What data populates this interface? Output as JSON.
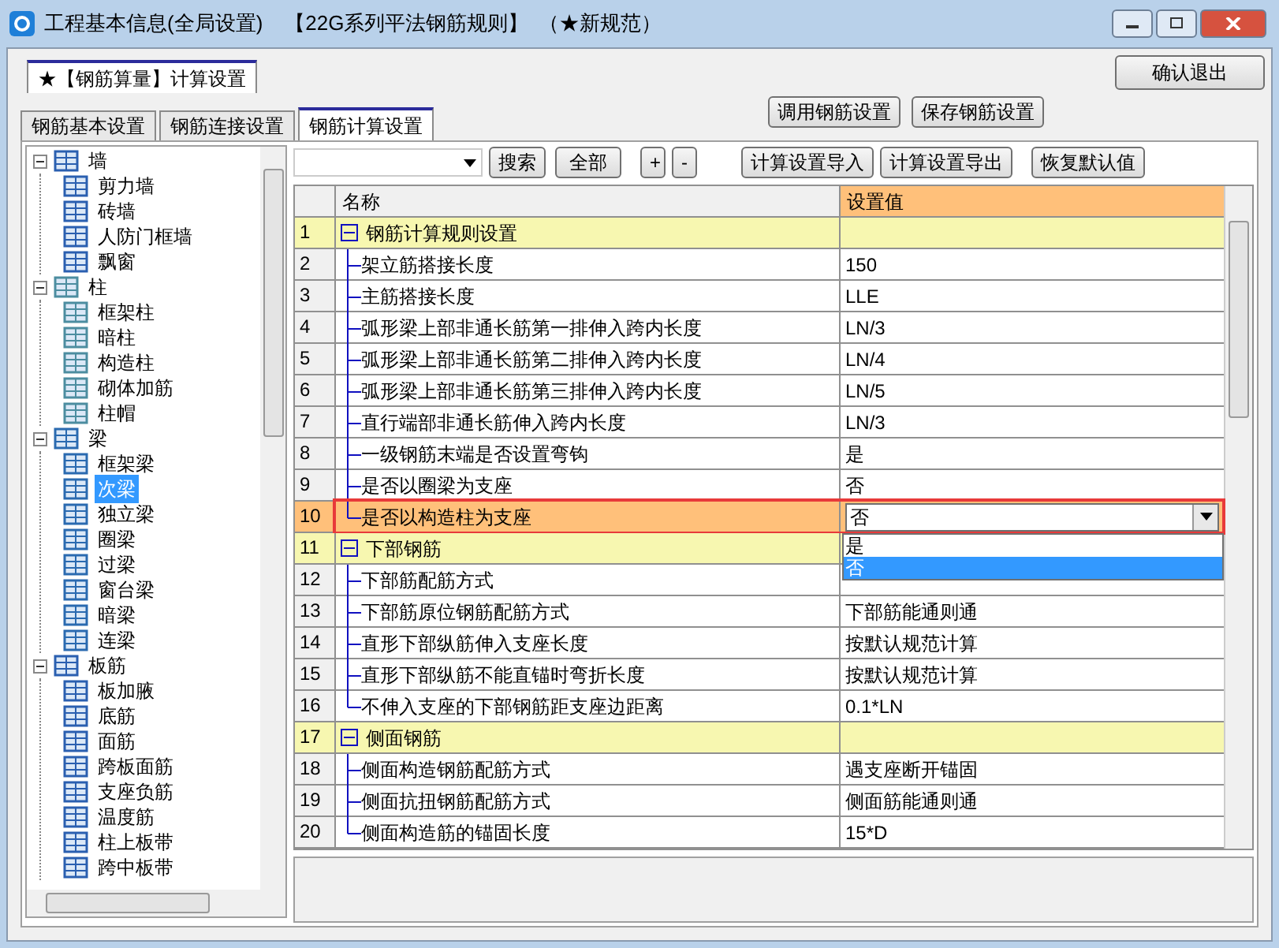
{
  "window": {
    "title": "工程基本信息(全局设置)",
    "rule_set": "【22G系列平法钢筋规则】",
    "note": "（★新规范）"
  },
  "outer_tabs": [
    {
      "label": "★【钢筋算量】计算设置",
      "selected": true
    }
  ],
  "confirm_button": "确认退出",
  "tabs": [
    {
      "label": "钢筋基本设置",
      "selected": false
    },
    {
      "label": "钢筋连接设置",
      "selected": false
    },
    {
      "label": "钢筋计算设置",
      "selected": true
    }
  ],
  "top_buttons": [
    "调用钢筋设置",
    "保存钢筋设置"
  ],
  "tree": [
    {
      "label": "墙",
      "expanded": true,
      "selected": false,
      "children": [
        {
          "label": "剪力墙",
          "selected": false
        },
        {
          "label": "砖墙",
          "selected": false
        },
        {
          "label": "人防门框墙",
          "selected": false
        },
        {
          "label": "飘窗",
          "selected": false
        }
      ]
    },
    {
      "label": "柱",
      "expanded": true,
      "selected": false,
      "children": [
        {
          "label": "框架柱",
          "selected": false
        },
        {
          "label": "暗柱",
          "selected": false
        },
        {
          "label": "构造柱",
          "selected": false
        },
        {
          "label": "砌体加筋",
          "selected": false
        },
        {
          "label": "柱帽",
          "selected": false
        }
      ]
    },
    {
      "label": "梁",
      "expanded": true,
      "selected": false,
      "children": [
        {
          "label": "框架梁",
          "selected": false
        },
        {
          "label": "次梁",
          "selected": true
        },
        {
          "label": "独立梁",
          "selected": false
        },
        {
          "label": "圈梁",
          "selected": false
        },
        {
          "label": "过梁",
          "selected": false
        },
        {
          "label": "窗台梁",
          "selected": false
        },
        {
          "label": "暗梁",
          "selected": false
        },
        {
          "label": "连梁",
          "selected": false
        }
      ]
    },
    {
      "label": "板筋",
      "expanded": true,
      "selected": false,
      "children": [
        {
          "label": "板加腋",
          "selected": false
        },
        {
          "label": "底筋",
          "selected": false
        },
        {
          "label": "面筋",
          "selected": false
        },
        {
          "label": "跨板面筋",
          "selected": false
        },
        {
          "label": "支座负筋",
          "selected": false
        },
        {
          "label": "温度筋",
          "selected": false
        },
        {
          "label": "柱上板带",
          "selected": false
        },
        {
          "label": "跨中板带",
          "selected": false
        }
      ]
    }
  ],
  "toolbar": {
    "search_button": "搜索",
    "all_button": "全部",
    "expand_button": "+",
    "collapse_button": "-",
    "import_button": "计算设置导入",
    "export_button": "计算设置导出",
    "reset_button": "恢复默认值"
  },
  "table": {
    "columns": [
      "名称",
      "设置值"
    ],
    "rows": [
      {
        "number": "1",
        "kind": "group",
        "name": "钢筋计算规则设置",
        "expanded": true,
        "selected": false
      },
      {
        "number": "2",
        "kind": "item",
        "name": "架立筋搭接长度",
        "value": "150",
        "selected": false
      },
      {
        "number": "3",
        "kind": "item",
        "name": "主筋搭接长度",
        "value": "LLE",
        "selected": false
      },
      {
        "number": "4",
        "kind": "item",
        "name": "弧形梁上部非通长筋第一排伸入跨内长度",
        "value": "LN/3",
        "selected": false
      },
      {
        "number": "5",
        "kind": "item",
        "name": "弧形梁上部非通长筋第二排伸入跨内长度",
        "value": "LN/4",
        "selected": false
      },
      {
        "number": "6",
        "kind": "item",
        "name": "弧形梁上部非通长筋第三排伸入跨内长度",
        "value": "LN/5",
        "selected": false
      },
      {
        "number": "7",
        "kind": "item",
        "name": "直行端部非通长筋伸入跨内长度",
        "value": "LN/3",
        "selected": false
      },
      {
        "number": "8",
        "kind": "item",
        "name": "一级钢筋末端是否设置弯钩",
        "value": "是",
        "selected": false
      },
      {
        "number": "9",
        "kind": "item",
        "name": "是否以圈梁为支座",
        "value": "否",
        "selected": false
      },
      {
        "number": "10",
        "kind": "item",
        "name": "是否以构造柱为支座",
        "value": "否",
        "selected": true,
        "options": [
          {
            "label": "是",
            "selected": false
          },
          {
            "label": "否",
            "selected": true
          }
        ]
      },
      {
        "number": "11",
        "kind": "group",
        "name": "下部钢筋",
        "expanded": true,
        "selected": false
      },
      {
        "number": "12",
        "kind": "item",
        "name": "下部筋配筋方式",
        "selected": false
      },
      {
        "number": "13",
        "kind": "item",
        "name": "下部筋原位钢筋配筋方式",
        "value": "下部筋能通则通",
        "selected": false
      },
      {
        "number": "14",
        "kind": "item",
        "name": "直形下部纵筋伸入支座长度",
        "value": "按默认规范计算",
        "selected": false
      },
      {
        "number": "15",
        "kind": "item",
        "name": "直形下部纵筋不能直锚时弯折长度",
        "value": "按默认规范计算",
        "selected": false
      },
      {
        "number": "16",
        "kind": "item",
        "name": "不伸入支座的下部钢筋距支座边距离",
        "value": "0.1*LN",
        "selected": false
      },
      {
        "number": "17",
        "kind": "group",
        "name": "侧面钢筋",
        "expanded": true,
        "selected": false
      },
      {
        "number": "18",
        "kind": "item",
        "name": "侧面构造钢筋配筋方式",
        "value": "遇支座断开锚固",
        "selected": false
      },
      {
        "number": "19",
        "kind": "item",
        "name": "侧面抗扭钢筋配筋方式",
        "value": "侧面筋能通则通",
        "selected": false
      },
      {
        "number": "20",
        "kind": "item",
        "name": "侧面构造筋的锚固长度",
        "value": "15*D",
        "selected": false
      }
    ]
  }
}
